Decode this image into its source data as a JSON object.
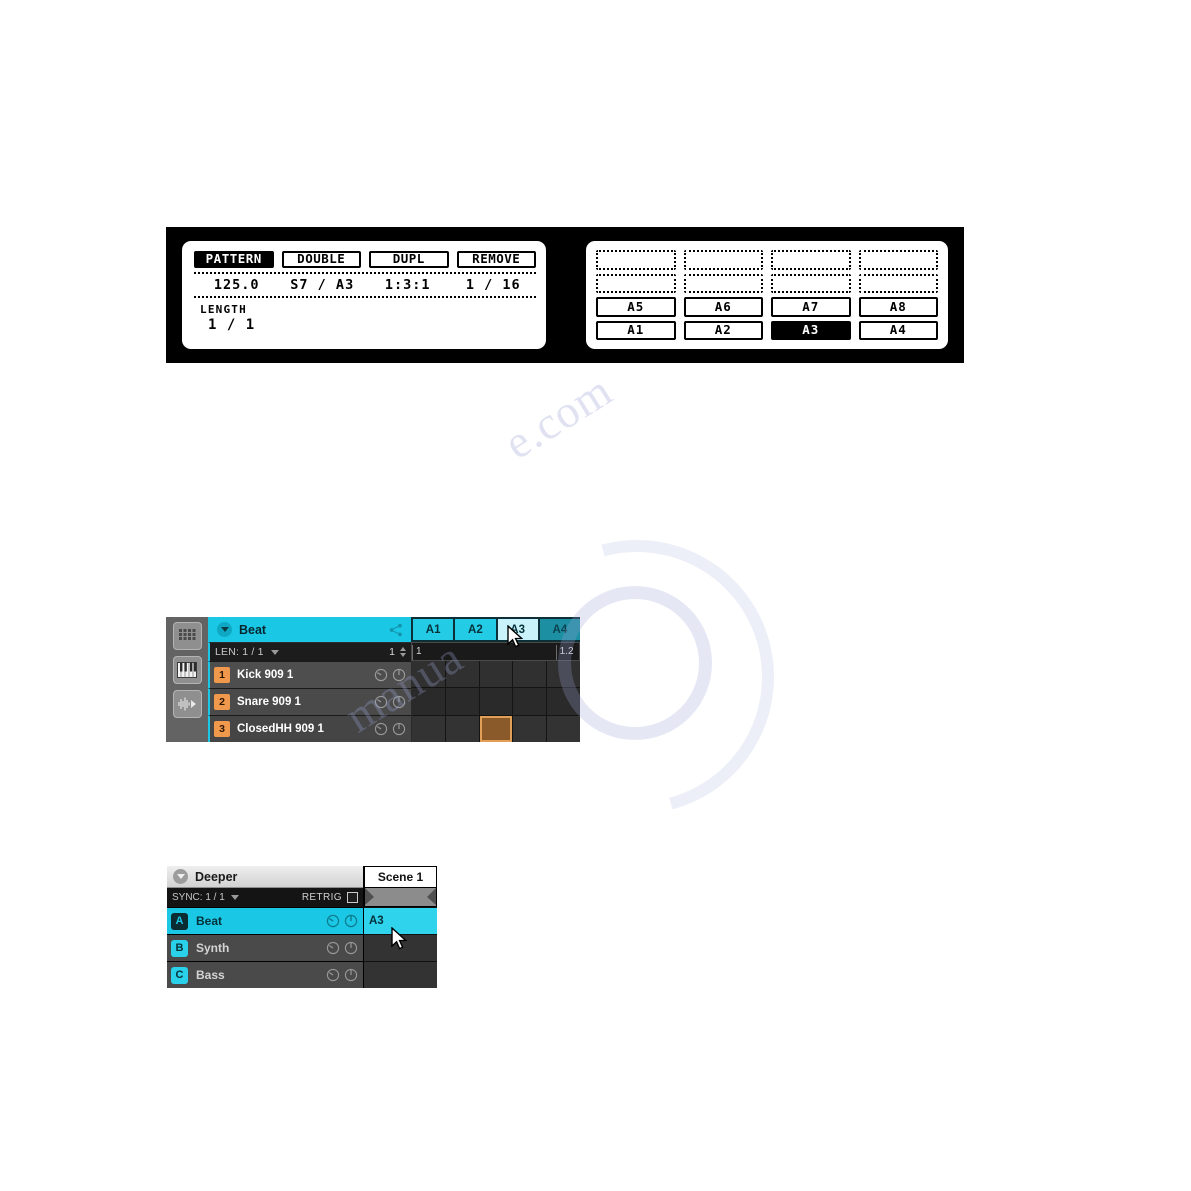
{
  "lcd_left": {
    "buttons": [
      {
        "label": "PATTERN",
        "state": "inverted"
      },
      {
        "label": "DOUBLE",
        "state": "normal"
      },
      {
        "label": "DUPL",
        "state": "normal"
      },
      {
        "label": "REMOVE",
        "state": "normal"
      }
    ],
    "values": [
      "125.0",
      "S7 / A3",
      "1:3:1",
      "1 / 16"
    ],
    "length_label": "LENGTH",
    "length_value": "1 / 1"
  },
  "lcd_right": {
    "pads": [
      {
        "label": "",
        "state": "empty"
      },
      {
        "label": "",
        "state": "empty"
      },
      {
        "label": "",
        "state": "empty"
      },
      {
        "label": "",
        "state": "empty"
      },
      {
        "label": "",
        "state": "empty"
      },
      {
        "label": "",
        "state": "empty"
      },
      {
        "label": "",
        "state": "empty"
      },
      {
        "label": "",
        "state": "empty"
      },
      {
        "label": "A5",
        "state": "normal"
      },
      {
        "label": "A6",
        "state": "normal"
      },
      {
        "label": "A7",
        "state": "normal"
      },
      {
        "label": "A8",
        "state": "normal"
      },
      {
        "label": "A1",
        "state": "normal"
      },
      {
        "label": "A2",
        "state": "normal"
      },
      {
        "label": "A3",
        "state": "selected"
      },
      {
        "label": "A4",
        "state": "normal"
      }
    ]
  },
  "pattern_editor": {
    "mode_icons": [
      "pad-grid-icon",
      "keyboard-icon",
      "waveform-icon"
    ],
    "group_name": "Beat",
    "tabs": [
      {
        "label": "A1",
        "state": "normal"
      },
      {
        "label": "A2",
        "state": "normal"
      },
      {
        "label": "A3",
        "state": "hover"
      },
      {
        "label": "A4",
        "state": "dim"
      }
    ],
    "len_label": "LEN: 1 / 1",
    "len_number": "1",
    "ruler_marks": [
      {
        "label": "1",
        "left_pct": 0
      },
      {
        "label": "1.2",
        "left_pct": 86
      }
    ],
    "sounds": [
      {
        "index": "1",
        "name": "Kick 909 1"
      },
      {
        "index": "2",
        "name": "Snare 909 1"
      },
      {
        "index": "3",
        "name": "ClosedHH 909 1"
      }
    ],
    "grid": {
      "columns": 5,
      "rows": 3,
      "notes": [
        {
          "row": 3,
          "col": 3
        }
      ]
    }
  },
  "arranger": {
    "project_name": "Deeper",
    "sync_label": "SYNC: 1 / 1",
    "retrig_label": "RETRIG",
    "retrig_checked": false,
    "groups": [
      {
        "letter": "A",
        "name": "Beat",
        "active": true
      },
      {
        "letter": "B",
        "name": "Synth",
        "active": false
      },
      {
        "letter": "C",
        "name": "Bass",
        "active": false
      }
    ],
    "scene_header": "Scene 1",
    "scene_slots": [
      {
        "label": "A3",
        "filled": true
      },
      {
        "label": "",
        "filled": false
      },
      {
        "label": "",
        "filled": false
      }
    ]
  },
  "watermark": {
    "line1": "e.com",
    "line2": "manua"
  },
  "colors": {
    "cyan": "#1ac8e6",
    "orange": "#f0984c",
    "lcd_bg": "#ffffff",
    "panel_bg": "#1b1b1b"
  }
}
